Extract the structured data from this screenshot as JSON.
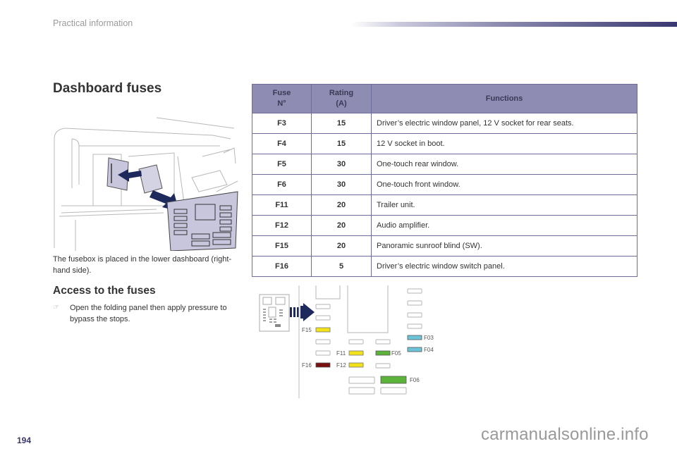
{
  "header": {
    "section_title": "Practical information",
    "accent_color": "#3a3870"
  },
  "page_title": "Dashboard fuses",
  "caption": "The fusebox is placed in the lower dashboard (right-hand side).",
  "access": {
    "title": "Access to the fuses",
    "bullet_icon": "pointing-hand-icon",
    "bullet_text": "Open the folding panel then apply pressure to bypass the stops."
  },
  "table": {
    "headers": [
      "Fuse\nN°",
      "Rating\n(A)",
      "Functions"
    ],
    "header_line1": [
      "Fuse",
      "Rating",
      "Functions"
    ],
    "header_line2": [
      "N°",
      "(A)",
      ""
    ],
    "rows": [
      {
        "fuse": "F3",
        "rating": "15",
        "function": "Driver’s electric window panel, 12 V socket for rear seats."
      },
      {
        "fuse": "F4",
        "rating": "15",
        "function": "12 V socket in boot."
      },
      {
        "fuse": "F5",
        "rating": "30",
        "function": "One-touch rear window."
      },
      {
        "fuse": "F6",
        "rating": "30",
        "function": "One-touch front window."
      },
      {
        "fuse": "F11",
        "rating": "20",
        "function": "Trailer unit."
      },
      {
        "fuse": "F12",
        "rating": "20",
        "function": "Audio amplifier."
      },
      {
        "fuse": "F15",
        "rating": "20",
        "function": "Panoramic sunroof blind (SW)."
      },
      {
        "fuse": "F16",
        "rating": "5",
        "function": "Driver’s electric window switch panel."
      }
    ]
  },
  "diagram": {
    "labels": {
      "F15": "F15",
      "F16": "F16",
      "F11": "F11",
      "F12": "F12",
      "F05": "F05",
      "F03": "F03",
      "F04": "F04",
      "F06": "F06"
    },
    "colors": {
      "yellow": "#f2e21a",
      "dark_red": "#7a0f0f",
      "green": "#5cb33a",
      "light_blue": "#6cc4d8",
      "arrow": "#1f2a5c"
    }
  },
  "footer": {
    "page_number": "194",
    "watermark": "carmanualsonline.info"
  }
}
